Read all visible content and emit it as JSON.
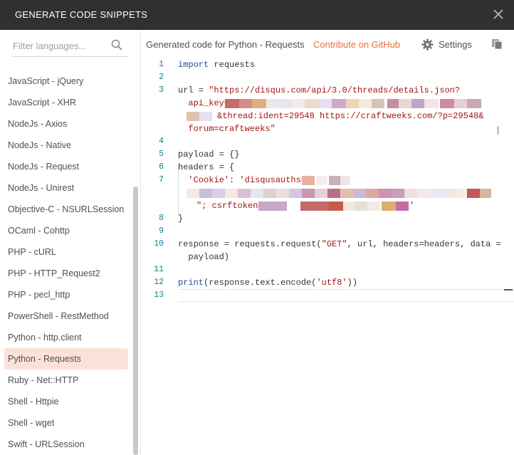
{
  "window": {
    "title": "GENERATE CODE SNIPPETS",
    "close_icon": "close-icon"
  },
  "sidebar": {
    "filter_placeholder": "Filter languages...",
    "filter_value": "",
    "items": [
      {
        "label": "JavaScript - jQuery"
      },
      {
        "label": "JavaScript - XHR"
      },
      {
        "label": "NodeJs - Axios"
      },
      {
        "label": "NodeJs - Native"
      },
      {
        "label": "NodeJs - Request"
      },
      {
        "label": "NodeJs - Unirest"
      },
      {
        "label": "Objective-C - NSURLSession"
      },
      {
        "label": "OCaml - Cohttp"
      },
      {
        "label": "PHP - cURL"
      },
      {
        "label": "PHP - HTTP_Request2"
      },
      {
        "label": "PHP - pecl_http"
      },
      {
        "label": "PowerShell - RestMethod"
      },
      {
        "label": "Python - http.client"
      },
      {
        "label": "Python - Requests"
      },
      {
        "label": "Ruby - Net::HTTP"
      },
      {
        "label": "Shell - Httpie"
      },
      {
        "label": "Shell - wget"
      },
      {
        "label": "Swift - URLSession"
      }
    ],
    "selected": "Python - Requests"
  },
  "main": {
    "generated_title": "Generated code for Python - Requests",
    "contribute_label": "Contribute on GitHub",
    "settings_label": "Settings",
    "colors": {
      "accent": "#f26b3a",
      "selected_bg": "#fce1d9",
      "titlebar": "#303030"
    }
  },
  "editor": {
    "line_numbers": [
      "1",
      "2",
      "3",
      "",
      "",
      "",
      "4",
      "5",
      "6",
      "7",
      "",
      "",
      "8",
      "9",
      "10",
      "",
      "11",
      "12",
      "13"
    ],
    "lines": {
      "l1_kw": "import",
      "l1_rest": " requests",
      "l3_a": "url = ",
      "l3_b": "\"https://disqus.com/api/3.0/threads/details.json?",
      "l3_c": "  api_key=",
      "l3_d": "&thread:ident=29548 https://craftweeks.com/?p=29548&",
      "l3_e": "  forum=craftweeks\"",
      "l5": "payload = {}",
      "l6": "headers = {",
      "l7_a": "  ",
      "l7_b": "'Cookie'",
      "l7_c": ": ",
      "l7_d": "'disqusauths=\"",
      "l7_e": "\"; csrftoken=",
      "l7_f": "'",
      "l8": "}",
      "l10_a": "response = requests.request(",
      "l10_b": "\"GET\"",
      "l10_c": ", url, headers=headers, data =",
      "l10_d": "  payload)",
      "l12_a": "print",
      "l12_b": "(response.text.encode(",
      "l12_c": "'utf8'",
      "l12_d": "))"
    }
  }
}
